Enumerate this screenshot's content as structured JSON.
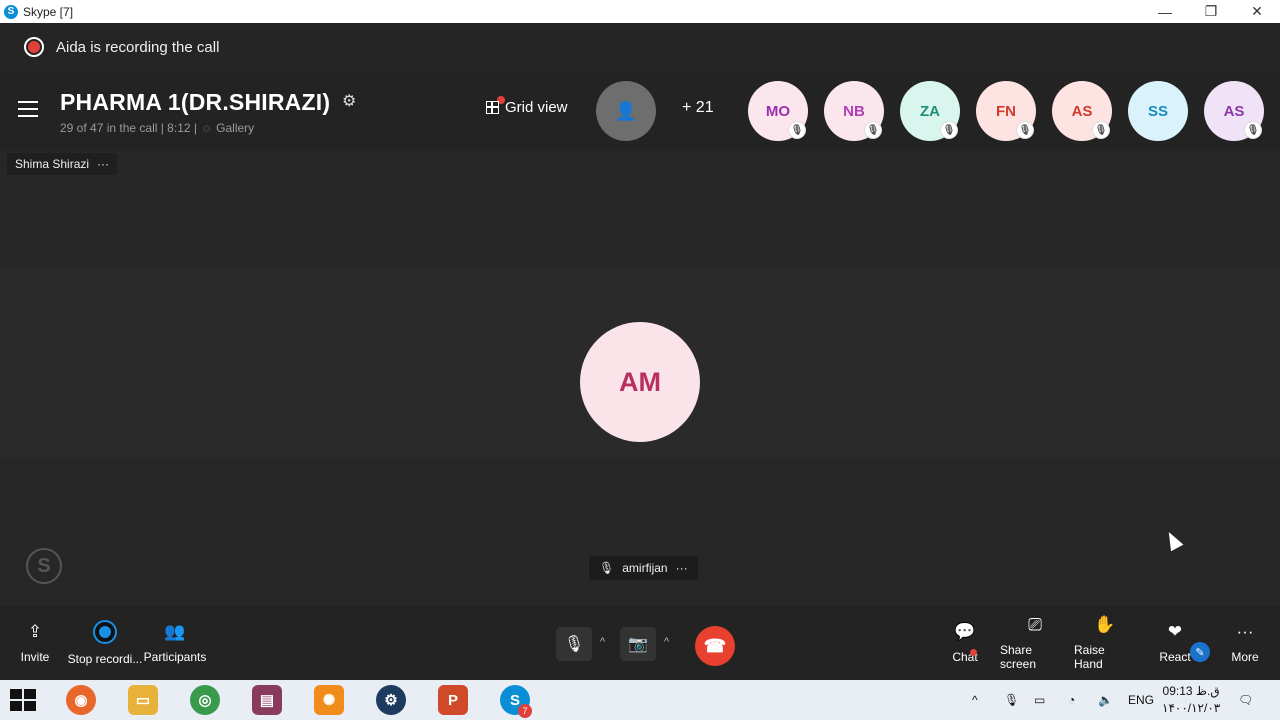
{
  "window": {
    "title": "Skype [7]",
    "controls": {
      "minimize": "—",
      "restore": "❐",
      "close": "✕"
    }
  },
  "recording": {
    "text": "Aida is recording the call"
  },
  "header": {
    "call_title": "PHARMA 1(DR.SHIRAZI)",
    "status": "29 of 47 in the call | 8:12 |",
    "view_mode": "Gallery",
    "grid_view_label": "Grid view",
    "more_participants": "+ 21"
  },
  "participants_strip": [
    {
      "initials": "MO",
      "bg": "#fbe6ee",
      "fg": "#9b2fb0"
    },
    {
      "initials": "NB",
      "bg": "#fbe6ee",
      "fg": "#b03fb8"
    },
    {
      "initials": "ZA",
      "bg": "#d8f5ee",
      "fg": "#1e8f78"
    },
    {
      "initials": "FN",
      "bg": "#fde3e1",
      "fg": "#d23a2c"
    },
    {
      "initials": "AS",
      "bg": "#fde3e1",
      "fg": "#d23a2c"
    },
    {
      "initials": "SS",
      "bg": "#d9f2fb",
      "fg": "#1b8cc0"
    },
    {
      "initials": "AS",
      "bg": "#f1e3f7",
      "fg": "#8a3aa8"
    }
  ],
  "stage": {
    "top_name_tag": "Shima Shirazi",
    "speaker_initials": "AM",
    "speaker_name": "amirfijan",
    "more_glyph": "···"
  },
  "toolbar": {
    "invite": "Invite",
    "stop_recording": "Stop recordi...",
    "participants": "Participants",
    "chat": "Chat",
    "share_screen": "Share screen",
    "raise_hand": "Raise Hand",
    "react": "React",
    "more": "More"
  },
  "taskbar": {
    "language": "ENG",
    "time": "09:13 ق.ظ",
    "date": "۱۴۰۰/۱۲/۰۳",
    "skype_badge": "7"
  },
  "colors": {
    "accent": "#1a8fe3",
    "recording_red": "#e0413b",
    "end_call_red": "#e8412f",
    "speaker_avatar_bg": "#fbe3ea",
    "speaker_avatar_fg": "#b93060"
  }
}
